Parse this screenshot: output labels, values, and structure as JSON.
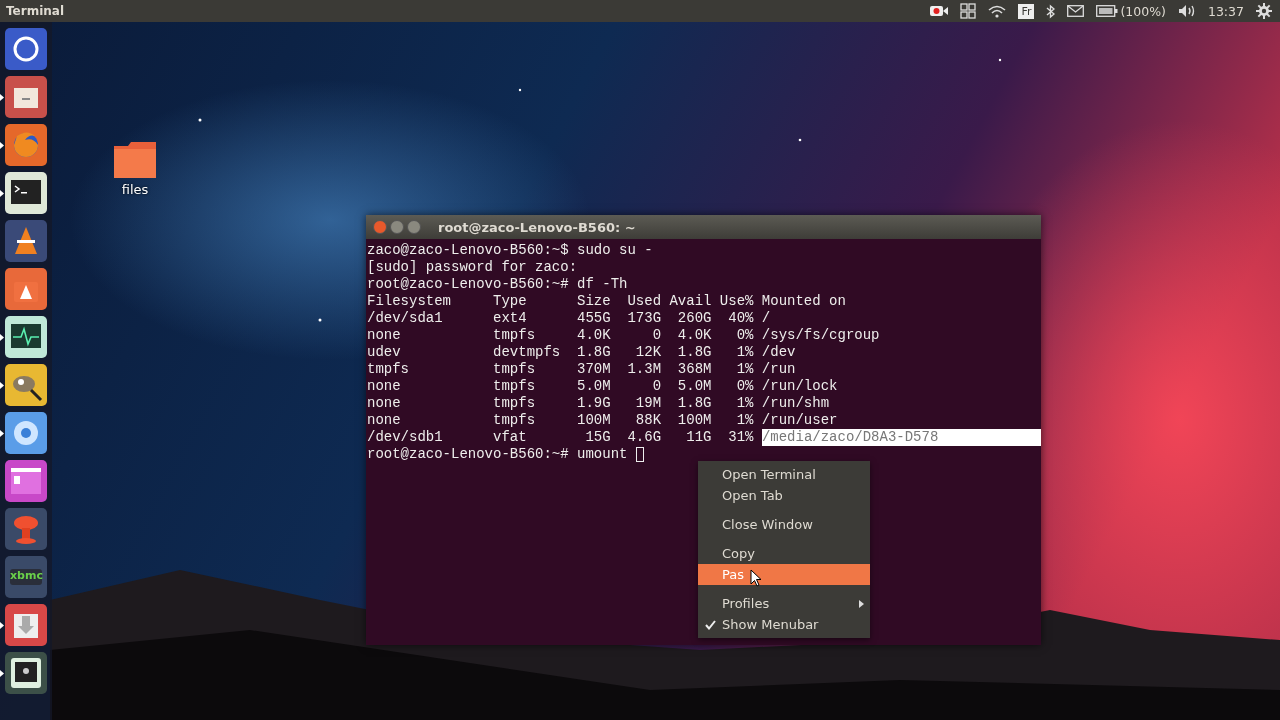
{
  "top_bar": {
    "app_title": "Terminal",
    "keyboard_layout": "Fr",
    "battery": "(100%)",
    "clock": "13:37"
  },
  "launcher": [
    {
      "color": "#3a5bc8",
      "running": false
    },
    {
      "color": "#c8504a",
      "running": true
    },
    {
      "color": "#e5682a",
      "running": true
    },
    {
      "color": "#dfe8d8",
      "running": true
    },
    {
      "color": "#3a4a78",
      "running": false
    },
    {
      "color": "#e8693a",
      "running": false
    },
    {
      "color": "#bfe8d8",
      "running": true
    },
    {
      "color": "#e8b832",
      "running": true
    },
    {
      "color": "#5a9de8",
      "running": true
    },
    {
      "color": "#c848c8",
      "running": false
    },
    {
      "color": "#3a4a68",
      "running": false
    },
    {
      "color": "#3a4a68",
      "running": false,
      "label": "xbmc"
    },
    {
      "color": "#d84848",
      "running": true
    },
    {
      "color": "#3c5048",
      "running": true
    }
  ],
  "desktop_icons": [
    {
      "label": "files"
    }
  ],
  "terminal": {
    "title": "root@zaco-Lenovo-B560: ~",
    "lines": [
      {
        "text": "zaco@zaco-Lenovo-B560:~$ sudo su -",
        "cursor": false
      },
      {
        "text": "[sudo] password for zaco:",
        "cursor": false
      },
      {
        "text": "root@zaco-Lenovo-B560:~# df -Th",
        "cursor": false
      },
      {
        "text": "Filesystem     Type      Size  Used Avail Use% Mounted on",
        "cursor": false
      },
      {
        "text": "/dev/sda1      ext4      455G  173G  260G  40% /",
        "cursor": false
      },
      {
        "text": "none           tmpfs     4.0K     0  4.0K   0% /sys/fs/cgroup",
        "cursor": false
      },
      {
        "text": "udev           devtmpfs  1.8G   12K  1.8G   1% /dev",
        "cursor": false
      },
      {
        "text": "tmpfs          tmpfs     370M  1.3M  368M   1% /run",
        "cursor": false
      },
      {
        "text": "none           tmpfs     5.0M     0  5.0M   0% /run/lock",
        "cursor": false
      },
      {
        "text": "none           tmpfs     1.9G   19M  1.8G   1% /run/shm",
        "cursor": false
      },
      {
        "text": "none           tmpfs     100M   88K  100M   1% /run/user",
        "cursor": false
      },
      {
        "text": "/dev/sdb1      vfat       15G  4.6G   11G  31% ",
        "selected_text": "/media/zaco/D8A3-D578",
        "cursor": false
      },
      {
        "text": "root@zaco-Lenovo-B560:~# umount ",
        "cursor": true
      }
    ]
  },
  "context_menu": [
    {
      "kind": "item",
      "label": "Open Terminal",
      "selected": false
    },
    {
      "kind": "item",
      "label": "Open Tab",
      "selected": false
    },
    {
      "kind": "separator"
    },
    {
      "kind": "item",
      "label": "Close Window",
      "selected": false
    },
    {
      "kind": "separator"
    },
    {
      "kind": "item",
      "label": "Copy",
      "selected": false
    },
    {
      "kind": "item",
      "label": "Pas",
      "selected": true
    },
    {
      "kind": "separator"
    },
    {
      "kind": "submenu",
      "label": "Profiles",
      "selected": false
    },
    {
      "kind": "check",
      "label": "Show Menubar",
      "selected": false,
      "checked": true
    }
  ]
}
